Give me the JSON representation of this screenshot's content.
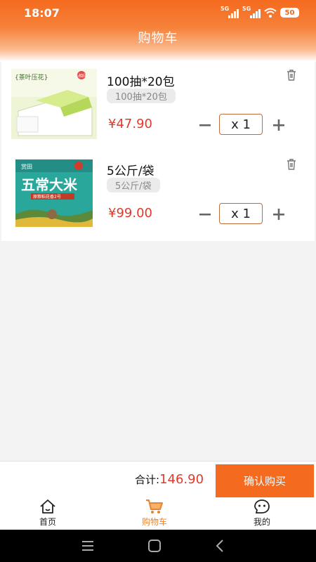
{
  "status_bar": {
    "time": "18:07",
    "network_1": "5G",
    "network_2": "5G",
    "battery": "50"
  },
  "header": {
    "title": "购物车"
  },
  "cart": {
    "items": [
      {
        "name": "100抽*20包",
        "spec": "100抽*20包",
        "price": "¥47.90",
        "quantity_label": "x  1",
        "image": "tissue-product-image"
      },
      {
        "name": "5公斤/袋",
        "spec": "5公斤/袋",
        "price": "¥99.00",
        "quantity_label": "x  1",
        "image": "rice-bag-product-image"
      }
    ]
  },
  "checkout": {
    "total_label": "合计:",
    "total_value": "146.90",
    "confirm_label": "确认购买"
  },
  "tabbar": {
    "tabs": [
      {
        "label": "首页",
        "icon": "home-icon",
        "active": false
      },
      {
        "label": "购物车",
        "icon": "cart-icon",
        "active": true
      },
      {
        "label": "我的",
        "icon": "profile-face-icon",
        "active": false
      }
    ]
  },
  "navbar": {
    "buttons": [
      "menu-icon",
      "home-square-icon",
      "back-icon"
    ]
  },
  "product_images": {
    "tissue": {
      "title_text": "{茶叶压花}",
      "brand_text": "心相印"
    },
    "rice": {
      "title_text": "五常大米",
      "brand_text": "赏田",
      "subtitle_text": "原粮稻花香2号"
    }
  },
  "colors": {
    "accent": "#f46a1e",
    "price": "#e03a2a",
    "tab_active": "#e8852f"
  }
}
